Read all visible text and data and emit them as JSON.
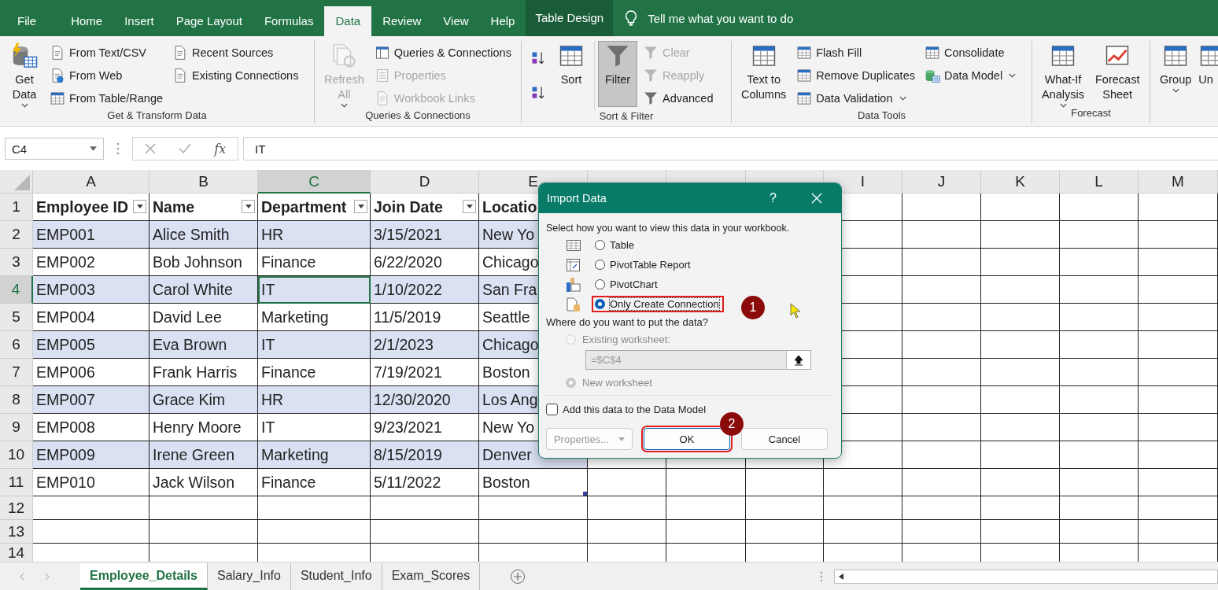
{
  "menu_tabs": [
    {
      "label": "File",
      "selected": false,
      "kind": "standard"
    },
    {
      "label": "Home",
      "selected": false,
      "kind": "standard"
    },
    {
      "label": "Insert",
      "selected": false,
      "kind": "standard"
    },
    {
      "label": "Page Layout",
      "selected": false,
      "kind": "standard"
    },
    {
      "label": "Formulas",
      "selected": false,
      "kind": "standard"
    },
    {
      "label": "Data",
      "selected": true,
      "kind": "standard"
    },
    {
      "label": "Review",
      "selected": false,
      "kind": "standard"
    },
    {
      "label": "View",
      "selected": false,
      "kind": "standard"
    },
    {
      "label": "Help",
      "selected": false,
      "kind": "standard"
    },
    {
      "label": "Table Design",
      "selected": false,
      "kind": "contextual"
    }
  ],
  "tell_me": {
    "placeholder": "Tell me what you want to do"
  },
  "ribbon_groups": [
    {
      "label": "Get & Transform Data",
      "columns": [
        {
          "items": [
            {
              "label": "Get\nData",
              "kind": "large",
              "dropdown": true,
              "disabled": false
            }
          ]
        },
        {
          "items": [
            {
              "label": "From Text/CSV",
              "kind": "small",
              "disabled": false
            },
            {
              "label": "From Web",
              "kind": "small",
              "disabled": false
            },
            {
              "label": "From Table/Range",
              "kind": "small",
              "disabled": false
            }
          ]
        },
        {
          "items": [
            {
              "label": "Recent Sources",
              "kind": "small",
              "disabled": false
            },
            {
              "label": "Existing Connections",
              "kind": "small",
              "disabled": false
            }
          ]
        }
      ]
    },
    {
      "label": "Queries & Connections",
      "columns": [
        {
          "items": [
            {
              "label": "Refresh\nAll",
              "kind": "large",
              "dropdown": true,
              "disabled": true
            }
          ]
        },
        {
          "items": [
            {
              "label": "Queries & Connections",
              "kind": "small",
              "disabled": false
            },
            {
              "label": "Properties",
              "kind": "small",
              "disabled": true
            },
            {
              "label": "Workbook Links",
              "kind": "small",
              "disabled": true
            }
          ]
        }
      ]
    },
    {
      "label": "Sort & Filter",
      "columns": [
        {
          "items": [
            {
              "kind": "icon",
              "disabled": false
            },
            {
              "kind": "icon",
              "disabled": false
            }
          ]
        },
        {
          "items": [
            {
              "label": "Sort",
              "kind": "large",
              "disabled": false,
              "pressed": false
            }
          ]
        },
        {
          "items": [
            {
              "label": "Filter",
              "kind": "large",
              "disabled": false,
              "pressed": true
            }
          ]
        },
        {
          "items": [
            {
              "label": "Clear",
              "kind": "small",
              "disabled": true
            },
            {
              "label": "Reapply",
              "kind": "small",
              "disabled": true
            },
            {
              "label": "Advanced",
              "kind": "small",
              "disabled": false
            }
          ]
        }
      ]
    },
    {
      "label": "Data Tools",
      "columns": [
        {
          "items": [
            {
              "label": "Text to\nColumns",
              "kind": "large",
              "disabled": false
            }
          ]
        },
        {
          "items": [
            {
              "label": "Flash Fill",
              "kind": "small",
              "disabled": false
            },
            {
              "label": "Remove Duplicates",
              "kind": "small",
              "disabled": false
            },
            {
              "label": "Data Validation",
              "kind": "small",
              "dropdown": true,
              "disabled": false
            }
          ]
        },
        {
          "items": [
            {
              "label": "Consolidate",
              "kind": "small",
              "disabled": false
            },
            {
              "label": "Data Model",
              "kind": "small",
              "dropdown": true,
              "disabled": false
            }
          ]
        }
      ]
    },
    {
      "label": "Forecast",
      "columns": [
        {
          "items": [
            {
              "label": "What-If\nAnalysis",
              "kind": "large",
              "dropdown": true,
              "disabled": false
            }
          ]
        },
        {
          "items": [
            {
              "label": "Forecast\nSheet",
              "kind": "large",
              "disabled": false
            }
          ]
        }
      ]
    },
    {
      "columns": [
        {
          "items": [
            {
              "label": "Group",
              "kind": "large",
              "dropdown": true,
              "disabled": false
            }
          ]
        },
        {
          "items": [
            {
              "label": "Un",
              "kind": "large",
              "disabled": false
            }
          ]
        }
      ]
    }
  ],
  "formula_bar": {
    "name_box": "C4",
    "function_label": "fx",
    "value": "IT"
  },
  "sheet": {
    "columns": [
      {
        "label": "A",
        "selected": false
      },
      {
        "label": "B",
        "selected": false
      },
      {
        "label": "C",
        "selected": true
      },
      {
        "label": "D",
        "selected": false
      },
      {
        "label": "E",
        "selected": false
      },
      {
        "selected": false
      },
      {
        "selected": false
      },
      {
        "selected": false
      },
      {
        "label": "I",
        "selected": false
      },
      {
        "label": "J",
        "selected": false
      },
      {
        "label": "K",
        "selected": false
      },
      {
        "label": "L",
        "selected": false
      },
      {
        "label": "M",
        "selected": false
      }
    ],
    "rows": [
      {
        "number": "1",
        "selected": false,
        "kind": "header",
        "cells": [
          {
            "text": "Employee ID",
            "filter_button": true
          },
          {
            "text": "Name",
            "filter_button": true
          },
          {
            "text": "Department",
            "filter_button": true
          },
          {
            "text": "Join Date",
            "filter_button": true
          },
          {
            "text": "Locatio",
            "filter_button": false
          }
        ]
      },
      {
        "number": "2",
        "selected": false,
        "kind": "data",
        "cells": [
          "EMP001",
          "Alice Smith",
          "HR",
          "3/15/2021",
          "New Yo"
        ]
      },
      {
        "number": "3",
        "selected": false,
        "kind": "data",
        "cells": [
          "EMP002",
          "Bob Johnson",
          "Finance",
          "6/22/2020",
          "Chicago"
        ]
      },
      {
        "number": "4",
        "selected": true,
        "kind": "data",
        "cells": [
          "EMP003",
          "Carol White",
          "IT",
          "1/10/2022",
          "San Fra"
        ]
      },
      {
        "number": "5",
        "selected": false,
        "kind": "data",
        "cells": [
          "EMP004",
          "David Lee",
          "Marketing",
          "11/5/2019",
          "Seattle"
        ]
      },
      {
        "number": "6",
        "selected": false,
        "kind": "data",
        "cells": [
          "EMP005",
          "Eva Brown",
          "IT",
          "2/1/2023",
          "Chicago"
        ]
      },
      {
        "number": "7",
        "selected": false,
        "kind": "data",
        "cells": [
          "EMP006",
          "Frank Harris",
          "Finance",
          "7/19/2021",
          "Boston"
        ]
      },
      {
        "number": "8",
        "selected": false,
        "kind": "data",
        "cells": [
          "EMP007",
          "Grace Kim",
          "HR",
          "12/30/2020",
          "Los Ang"
        ]
      },
      {
        "number": "9",
        "selected": false,
        "kind": "data",
        "cells": [
          "EMP008",
          "Henry Moore",
          "IT",
          "9/23/2021",
          "New Yo"
        ]
      },
      {
        "number": "10",
        "selected": false,
        "kind": "data",
        "cells": [
          "EMP009",
          "Irene Green",
          "Marketing",
          "8/15/2019",
          "Denver"
        ]
      },
      {
        "number": "11",
        "selected": false,
        "kind": "data",
        "cells": [
          "EMP010",
          "Jack Wilson",
          "Finance",
          "5/11/2022",
          "Boston"
        ]
      },
      {
        "number": "12",
        "selected": false,
        "kind": "empty"
      },
      {
        "number": "13",
        "selected": false,
        "kind": "empty"
      },
      {
        "number": "14",
        "selected": false,
        "kind": "empty"
      }
    ]
  },
  "import_dialog": {
    "title": "Import Data",
    "help": "?",
    "view_prompt": "Select how you want to view this data in your workbook.",
    "view_options": [
      {
        "label": "Table",
        "selected": false,
        "highlighted": false
      },
      {
        "label": "PivotTable Report",
        "selected": false,
        "highlighted": false
      },
      {
        "label": "PivotChart",
        "selected": false,
        "highlighted": false
      },
      {
        "label": "Only Create Connection",
        "selected": true,
        "highlighted": true,
        "callout": "1"
      }
    ],
    "location_prompt": "Where do you want to put the data?",
    "location_options": [
      {
        "label": "Existing worksheet:",
        "selected": false,
        "disabled": true
      },
      {
        "label": "New worksheet",
        "selected": true,
        "disabled": true
      }
    ],
    "range_field": {
      "value": "=$C$4",
      "disabled": true
    },
    "data_model_checkbox": {
      "label": "Add this data to the Data Model",
      "checked": false
    },
    "buttons": [
      {
        "label": "Properties...",
        "kind": "split",
        "disabled": true,
        "highlighted": false
      },
      {
        "label": "OK",
        "kind": "plain",
        "disabled": false,
        "highlighted": true,
        "callout": "2"
      },
      {
        "label": "Cancel",
        "kind": "plain",
        "disabled": false,
        "highlighted": false
      }
    ]
  },
  "sheet_tabs": [
    {
      "label": "Employee_Details",
      "selected": true
    },
    {
      "label": "Salary_Info",
      "selected": false
    },
    {
      "label": "Student_Info",
      "selected": false
    },
    {
      "label": "Exam_Scores",
      "selected": false
    }
  ]
}
